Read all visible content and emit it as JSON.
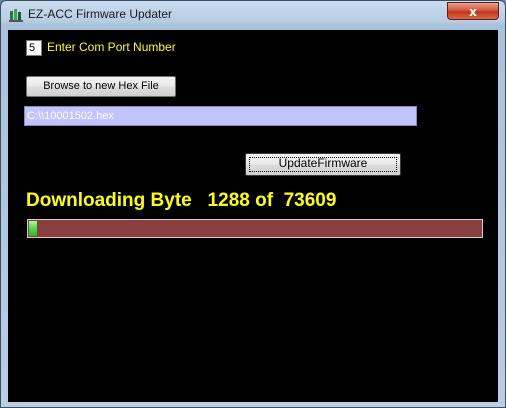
{
  "window": {
    "title": "EZ-ACC Firmware Updater",
    "close_label": "x"
  },
  "com_port": {
    "value": "5",
    "label": "Enter Com Port Number"
  },
  "file": {
    "browse_label": "Browse to new Hex File",
    "path": "C:\\\\10001502.hex"
  },
  "update": {
    "label": "UpdateFirmware"
  },
  "status": {
    "text": "Downloading Byte   1288 of  73609"
  },
  "progress": {
    "current": 1288,
    "total": 73609
  },
  "colors": {
    "label_text": "#ffff00",
    "background": "#000000",
    "progress_fill": "#4fdc4b",
    "progress_track": "#8a3f3f",
    "path_field": "#c3c3ff"
  },
  "icons": {
    "app": "app-icon",
    "close": "close-icon"
  }
}
